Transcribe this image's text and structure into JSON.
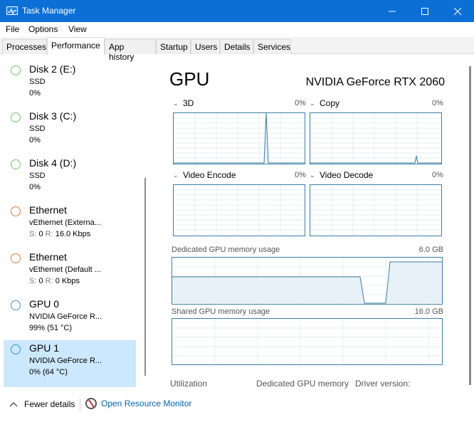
{
  "window": {
    "title": "Task Manager"
  },
  "menu": [
    "File",
    "Options",
    "View"
  ],
  "tabs": [
    "Processes",
    "Performance",
    "App history",
    "Startup",
    "Users",
    "Details",
    "Services"
  ],
  "active_tab": "Performance",
  "sidebar": {
    "items": [
      {
        "name": "Disk 2 (E:)",
        "line1": "SSD",
        "line2": "0%",
        "ring_color": "#6ccb5f"
      },
      {
        "name": "Disk 3 (C:)",
        "line1": "SSD",
        "line2": "0%",
        "ring_color": "#6ccb5f"
      },
      {
        "name": "Disk 4 (D:)",
        "line1": "SSD",
        "line2": "0%",
        "ring_color": "#6ccb5f"
      },
      {
        "name": "Ethernet",
        "line1": "vEthernet (Externa...",
        "line2_s_label": "S:",
        "line2_s": "0",
        "line2_r_label": "R:",
        "line2_r": "16.0 Kbps",
        "ring_color": "#e07a3d"
      },
      {
        "name": "Ethernet",
        "line1": "vEthernet (Default ...",
        "line2_s_label": "S:",
        "line2_s": "0",
        "line2_r_label": "R:",
        "line2_r": "0 Kbps",
        "ring_color": "#e07a3d"
      },
      {
        "name": "GPU 0",
        "line1": "NVIDIA GeForce R...",
        "line2": "99% (51 °C)",
        "ring_color": "#3b8fd1"
      },
      {
        "name": "GPU 1",
        "line1": "NVIDIA GeForce R...",
        "line2": "0% (64 °C)",
        "ring_color": "#3b8fd1",
        "selected": true
      }
    ]
  },
  "main": {
    "title": "GPU",
    "model": "NVIDIA GeForce RTX 2060",
    "engines": [
      {
        "label": "3D",
        "percent": "0%"
      },
      {
        "label": "Copy",
        "percent": "0%"
      },
      {
        "label": "Video Encode",
        "percent": "0%"
      },
      {
        "label": "Video Decode",
        "percent": "0%"
      }
    ],
    "dedicated": {
      "label": "Dedicated GPU memory usage",
      "max": "6.0 GB"
    },
    "shared": {
      "label": "Shared GPU memory usage",
      "max": "16.0 GB"
    },
    "stats": {
      "utilization": "Utilization",
      "dedicated_memory": "Dedicated GPU memory",
      "driver_version": "Driver version:"
    }
  },
  "footer": {
    "fewer_details": "Fewer details",
    "open_resource_monitor": "Open Resource Monitor"
  },
  "colors": {
    "titlebar": "#0b6fd6",
    "graph_border": "#3a7fa5",
    "graph_fill": "#e8f1f8",
    "selected": "#cce8ff"
  }
}
